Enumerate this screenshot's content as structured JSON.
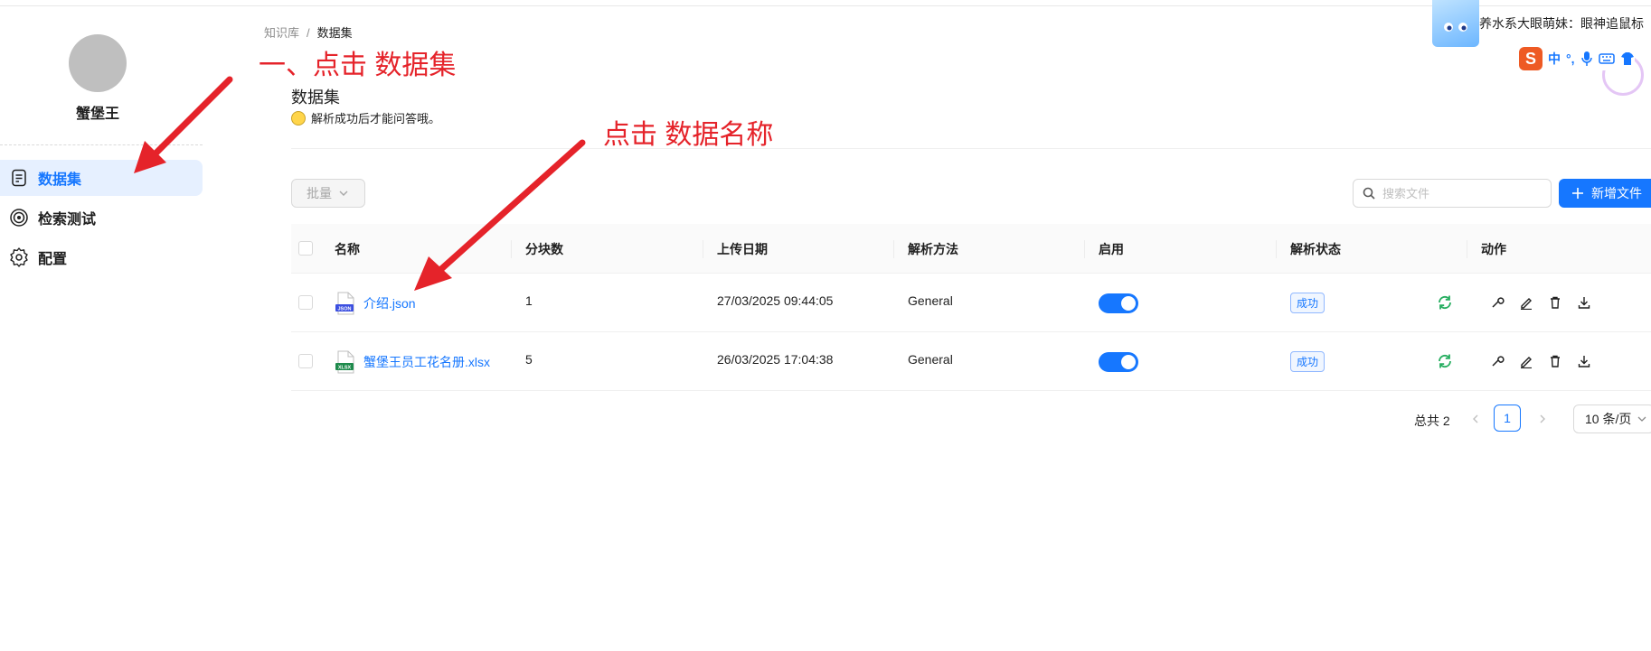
{
  "breadcrumb": {
    "root": "知识库",
    "separator": "/",
    "current": "数据集"
  },
  "sidebar": {
    "kb_name": "蟹堡王",
    "items": [
      {
        "label": "数据集",
        "icon": "document-icon",
        "active": true
      },
      {
        "label": "检索测试",
        "icon": "target-icon",
        "active": false
      },
      {
        "label": "配置",
        "icon": "gear-icon",
        "active": false
      }
    ]
  },
  "header": {
    "title": "数据集",
    "description": "解析成功后才能问答哦。"
  },
  "toolbar": {
    "batch_label": "批量",
    "search_placeholder": "搜索文件",
    "new_file_label": "新增文件"
  },
  "table": {
    "columns": [
      "名称",
      "分块数",
      "上传日期",
      "解析方法",
      "启用",
      "解析状态",
      "动作"
    ],
    "rows": [
      {
        "name": "介绍.json",
        "file_type": "JSON",
        "chunks": "1",
        "upload_date": "27/03/2025 09:44:05",
        "method": "General",
        "enabled": true,
        "status": "成功"
      },
      {
        "name": "蟹堡王员工花名册.xlsx",
        "file_type": "XLSX",
        "chunks": "5",
        "upload_date": "26/03/2025 17:04:38",
        "method": "General",
        "enabled": true,
        "status": "成功"
      }
    ]
  },
  "pagination": {
    "total_label": "总共 2",
    "current_page": "1",
    "page_size": "10 条/页"
  },
  "overlay": {
    "mascot_text": "养水系大眼萌妹：眼神追鼠标",
    "ime_logo": "S",
    "ime_mode": "中",
    "ime_punct": "°,"
  },
  "annotations": {
    "step1": "一、点击 数据集",
    "step2": "点击 数据名称"
  },
  "colors": {
    "accent": "#1677ff",
    "annotation": "#e5232a",
    "success_icon": "#27ae60"
  }
}
